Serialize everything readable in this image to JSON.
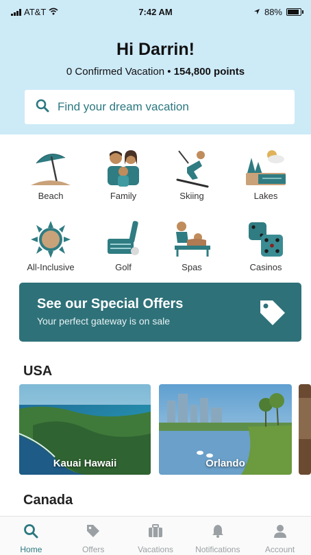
{
  "status_bar": {
    "carrier": "AT&T",
    "time": "7:42 AM",
    "battery": "88%"
  },
  "header": {
    "greeting": "Hi Darrin!",
    "confirmed": "0 Confirmed Vacation",
    "separator": "•",
    "points": "154,800 points"
  },
  "search": {
    "placeholder": "Find your dream vacation",
    "icon": "search-icon"
  },
  "categories": [
    {
      "label": "Beach",
      "icon": "beach-umbrella-icon"
    },
    {
      "label": "Family",
      "icon": "family-icon"
    },
    {
      "label": "Skiing",
      "icon": "skier-icon"
    },
    {
      "label": "Lakes",
      "icon": "lake-icon"
    },
    {
      "label": "All-Inclusive",
      "icon": "sun-icon"
    },
    {
      "label": "Golf",
      "icon": "golf-cart-icon"
    },
    {
      "label": "Spas",
      "icon": "spa-massage-icon"
    },
    {
      "label": "Casinos",
      "icon": "dice-icon"
    }
  ],
  "offer": {
    "title": "See our Special Offers",
    "subtitle": "Your perfect gateway is on sale",
    "icon": "tag-icon"
  },
  "sections": [
    {
      "title": "USA",
      "destinations": [
        {
          "name": "Kauai Hawaii"
        },
        {
          "name": "Orlando"
        }
      ]
    },
    {
      "title": "Canada"
    }
  ],
  "nav": [
    {
      "label": "Home",
      "icon": "search-icon",
      "active": true
    },
    {
      "label": "Offers",
      "icon": "tag-icon"
    },
    {
      "label": "Vacations",
      "icon": "suitcase-icon"
    },
    {
      "label": "Notifications",
      "icon": "bell-icon"
    },
    {
      "label": "Account",
      "icon": "person-icon"
    }
  ],
  "colors": {
    "header_bg": "#cdeaf7",
    "accent": "#2c7880",
    "offer_bg": "#2e7179",
    "icon_teal": "#2f7c82",
    "icon_tan": "#c9a27a"
  }
}
